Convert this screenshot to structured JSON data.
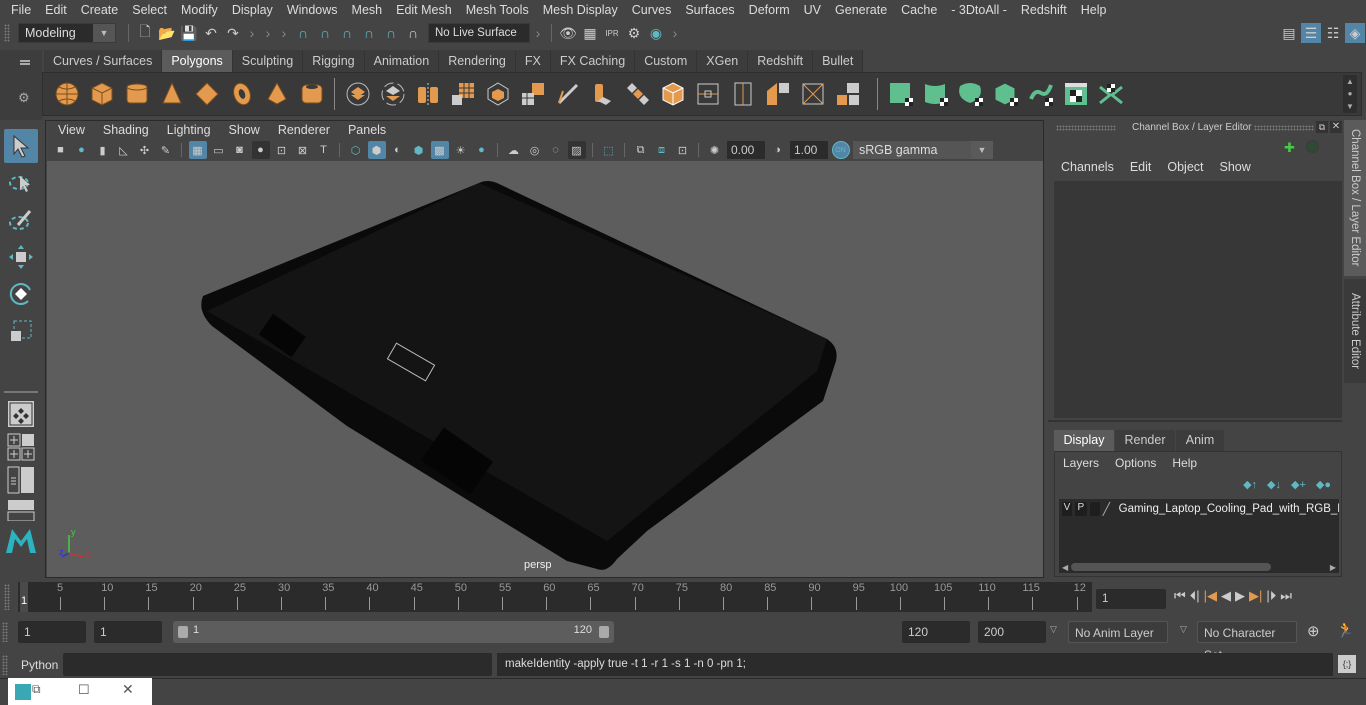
{
  "menubar": {
    "items": [
      "File",
      "Edit",
      "Create",
      "Select",
      "Modify",
      "Display",
      "Windows",
      "Mesh",
      "Edit Mesh",
      "Mesh Tools",
      "Mesh Display",
      "Curves",
      "Surfaces",
      "Deform",
      "UV",
      "Generate",
      "Cache",
      "- 3DtoAll -",
      "Redshift",
      "Help"
    ]
  },
  "statusline": {
    "mode_dropdown": "Modeling",
    "live_surface": "No Live Surface"
  },
  "shelf": {
    "tabs": [
      "Curves / Surfaces",
      "Polygons",
      "Sculpting",
      "Rigging",
      "Animation",
      "Rendering",
      "FX",
      "FX Caching",
      "Custom",
      "XGen",
      "Redshift",
      "Bullet"
    ],
    "active_tab": "Polygons",
    "colors": {
      "orange": "#e39a4e",
      "green": "#5fbf8e",
      "accent": "#5285a6"
    }
  },
  "viewport": {
    "menu": [
      "View",
      "Shading",
      "Lighting",
      "Show",
      "Renderer",
      "Panels"
    ],
    "exposure": "0.00",
    "gamma": "1.00",
    "color_management_toggle": "ON",
    "color_space": "sRGB gamma",
    "camera_label": "persp",
    "axis": {
      "x": "x",
      "y": "y",
      "z": "z"
    }
  },
  "channel_box": {
    "title": "Channel Box / Layer Editor",
    "menu": [
      "Channels",
      "Edit",
      "Object",
      "Show"
    ],
    "layer_tabs": [
      "Display",
      "Render",
      "Anim"
    ],
    "active_layer_tab": "Display",
    "layer_menu": [
      "Layers",
      "Options",
      "Help"
    ],
    "layers": [
      {
        "visible": "V",
        "playback": "P",
        "name": "Gaming_Laptop_Cooling_Pad_with_RGB_Lig"
      }
    ]
  },
  "side_tabs": [
    "Channel Box / Layer Editor",
    "Attribute Editor"
  ],
  "timeline": {
    "ticks": [
      "5",
      "10",
      "15",
      "20",
      "25",
      "30",
      "35",
      "40",
      "45",
      "50",
      "55",
      "60",
      "65",
      "70",
      "75",
      "80",
      "85",
      "90",
      "95",
      "100",
      "105",
      "110",
      "115",
      "12"
    ],
    "current_frame_marker": "1",
    "current_frame_field": "1"
  },
  "range": {
    "start_field": "1",
    "playback_start": "1",
    "slider_start": "1",
    "slider_end": "120",
    "playback_end": "120",
    "end_field": "200",
    "anim_layer": "No Anim Layer",
    "character_set": "No Character Set"
  },
  "command_line": {
    "language": "Python",
    "input_value": "",
    "result": "makeIdentity -apply true -t 1 -r 1 -s 1 -n 0 -pn 1;"
  }
}
